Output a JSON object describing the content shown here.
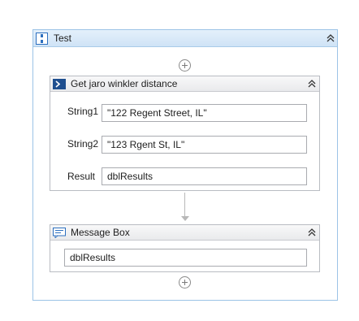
{
  "sequence": {
    "title": "Test",
    "icon": "sequence-icon",
    "collapse_icon": "collapse-chevron-icon"
  },
  "jaro_activity": {
    "title": "Get jaro winkler distance",
    "icon": "console-prompt-icon",
    "fields": [
      {
        "label": "String1",
        "value": "\"122 Regent Street, IL\""
      },
      {
        "label": "String2",
        "value": "\"123 Rgent St, IL\""
      },
      {
        "label": "Result",
        "value": "dblResults"
      }
    ]
  },
  "message_box": {
    "title": "Message Box",
    "icon": "message-box-icon",
    "value": "dblResults"
  },
  "colors": {
    "sequence_border": "#9cc3e6",
    "sequence_header": "#cfe3f6",
    "activity_border": "#b9bcc2",
    "accent": "#2c6fbf"
  }
}
